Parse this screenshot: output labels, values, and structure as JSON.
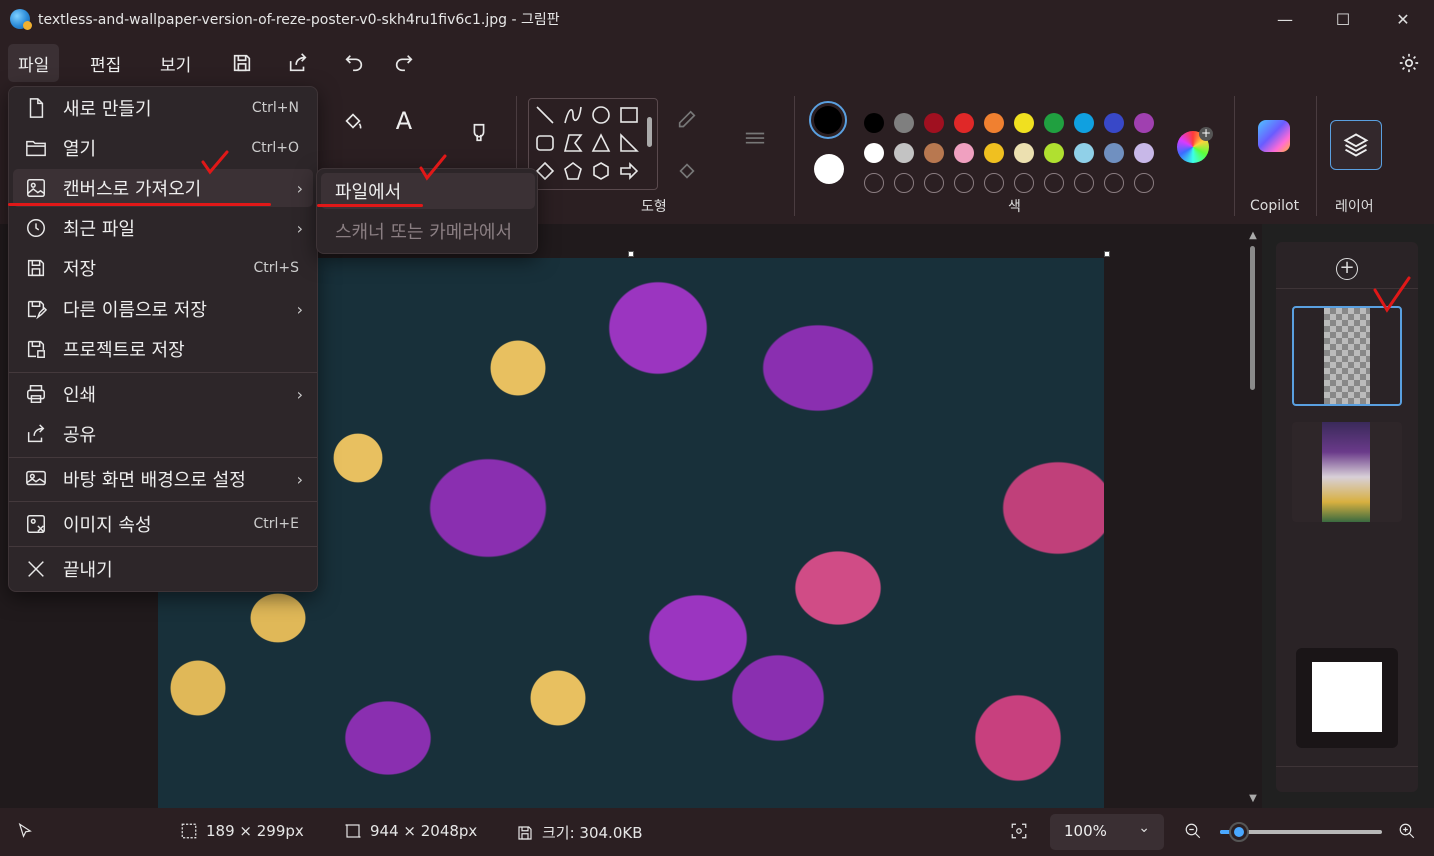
{
  "window": {
    "title": "textless-and-wallpaper-version-of-reze-poster-v0-skh4ru1fiv6c1.jpg - 그림판",
    "minimize_glyph": "—",
    "maximize_glyph": "☐",
    "close_glyph": "✕"
  },
  "menubar": {
    "tabs": [
      "파일",
      "편집",
      "보기"
    ]
  },
  "ribbon": {
    "shapes_label": "도형",
    "colors_label": "색",
    "copilot_label": "Copilot",
    "layers_label": "레이어",
    "text_tool_glyph": "A"
  },
  "palette": {
    "row1": [
      "#000000",
      "#7f7f7f",
      "#a01020",
      "#e02828",
      "#f08030",
      "#f0e020",
      "#20a040",
      "#10a0e0",
      "#3848c8",
      "#a040b0"
    ],
    "row2": [
      "#ffffff",
      "#c3c3c3",
      "#b87850",
      "#f0a0c0",
      "#f0c020",
      "#ece0b0",
      "#b0e030",
      "#90d0e8",
      "#7090c0",
      "#c8b8e8"
    ],
    "primary": "#000000",
    "secondary": "#ffffff"
  },
  "file_menu": {
    "items": [
      {
        "label": "새로 만들기",
        "shortcut": "Ctrl+N",
        "arrow": ""
      },
      {
        "label": "열기",
        "shortcut": "Ctrl+O",
        "arrow": ""
      },
      {
        "label": "캔버스로 가져오기",
        "shortcut": "",
        "arrow": "›"
      },
      {
        "label": "최근 파일",
        "shortcut": "",
        "arrow": "›"
      },
      {
        "label": "저장",
        "shortcut": "Ctrl+S",
        "arrow": ""
      },
      {
        "label": "다른 이름으로 저장",
        "shortcut": "",
        "arrow": "›"
      },
      {
        "label": "프로젝트로 저장",
        "shortcut": "",
        "arrow": ""
      },
      {
        "label": "인쇄",
        "shortcut": "",
        "arrow": "›"
      },
      {
        "label": "공유",
        "shortcut": "",
        "arrow": ""
      },
      {
        "label": "바탕 화면 배경으로 설정",
        "shortcut": "",
        "arrow": "›"
      },
      {
        "label": "이미지 속성",
        "shortcut": "Ctrl+E",
        "arrow": ""
      },
      {
        "label": "끝내기",
        "shortcut": "",
        "arrow": ""
      }
    ]
  },
  "submenu": {
    "items": [
      "파일에서",
      "스캐너 또는 카메라에서"
    ]
  },
  "status": {
    "selection": "189 × 299px",
    "canvas_size": "944 × 2048px",
    "file_size": "크기: 304.0KB",
    "zoom": "100%",
    "zoom_fraction": 0.12
  }
}
